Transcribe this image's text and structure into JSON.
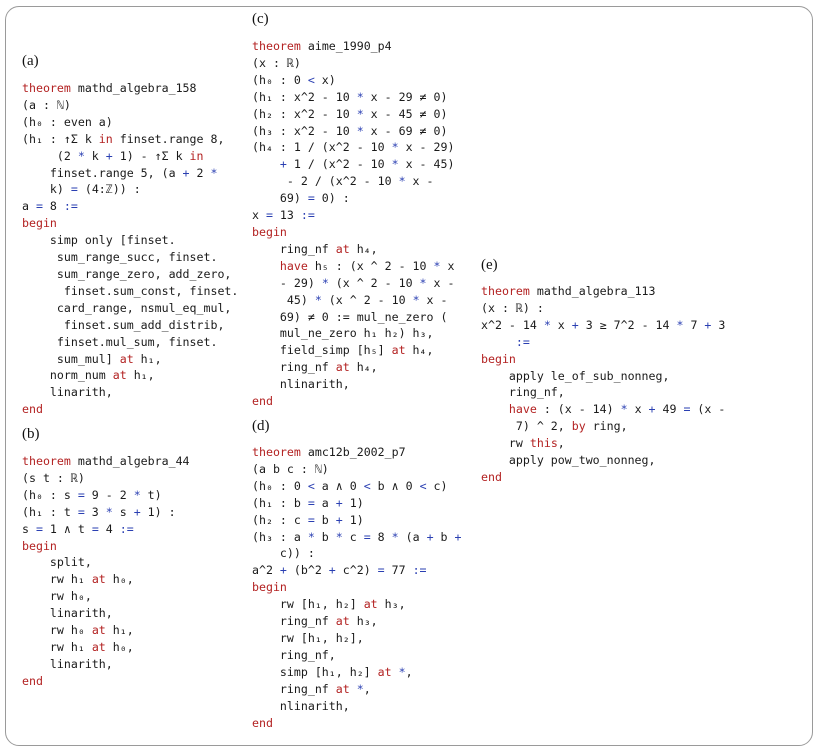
{
  "labels": {
    "a": "(a)",
    "b": "(b)",
    "c": "(c)",
    "d": "(d)",
    "e": "(e)"
  },
  "panels": {
    "a": [
      [
        [
          "k",
          "theorem"
        ],
        [
          "t",
          " mathd_algebra_158"
        ]
      ],
      [
        [
          "t",
          "(a : ℕ)"
        ]
      ],
      [
        [
          "t",
          "(h₀ : even a)"
        ]
      ],
      [
        [
          "t",
          "(h₁ : ↑Σ k "
        ],
        [
          "k",
          "in"
        ],
        [
          "t",
          " finset.range 8,"
        ]
      ],
      [
        [
          "t",
          "     (2 "
        ],
        [
          "o",
          "*"
        ],
        [
          "t",
          " k "
        ],
        [
          "o",
          "+"
        ],
        [
          "t",
          " 1) - ↑Σ k "
        ],
        [
          "k",
          "in"
        ]
      ],
      [
        [
          "t",
          "    finset.range 5, (a "
        ],
        [
          "o",
          "+"
        ],
        [
          "t",
          " 2 "
        ],
        [
          "o",
          "*"
        ]
      ],
      [
        [
          "t",
          "    k) "
        ],
        [
          "o",
          "="
        ],
        [
          "t",
          " (4:ℤ)) :"
        ]
      ],
      [
        [
          "t",
          "a "
        ],
        [
          "o",
          "="
        ],
        [
          "t",
          " 8 "
        ],
        [
          "o",
          ":="
        ]
      ],
      [
        [
          "k",
          "begin"
        ]
      ],
      [
        [
          "t",
          "    simp only [finset."
        ]
      ],
      [
        [
          "t",
          "     sum_range_succ, finset."
        ]
      ],
      [
        [
          "t",
          "     sum_range_zero, add_zero,"
        ]
      ],
      [
        [
          "t",
          "      finset.sum_const, finset."
        ]
      ],
      [
        [
          "t",
          "     card_range, nsmul_eq_mul,"
        ]
      ],
      [
        [
          "t",
          "      finset.sum_add_distrib,"
        ]
      ],
      [
        [
          "t",
          "     finset.mul_sum, finset."
        ]
      ],
      [
        [
          "t",
          "     sum_mul] "
        ],
        [
          "k",
          "at"
        ],
        [
          "t",
          " h₁,"
        ]
      ],
      [
        [
          "t",
          "    norm_num "
        ],
        [
          "k",
          "at"
        ],
        [
          "t",
          " h₁,"
        ]
      ],
      [
        [
          "t",
          "    linarith,"
        ]
      ],
      [
        [
          "k",
          "end"
        ]
      ]
    ],
    "b": [
      [
        [
          "k",
          "theorem"
        ],
        [
          "t",
          " mathd_algebra_44"
        ]
      ],
      [
        [
          "t",
          "(s t : ℝ)"
        ]
      ],
      [
        [
          "t",
          "(h₀ : s "
        ],
        [
          "o",
          "="
        ],
        [
          "t",
          " 9 - 2 "
        ],
        [
          "o",
          "*"
        ],
        [
          "t",
          " t)"
        ]
      ],
      [
        [
          "t",
          "(h₁ : t "
        ],
        [
          "o",
          "="
        ],
        [
          "t",
          " 3 "
        ],
        [
          "o",
          "*"
        ],
        [
          "t",
          " s "
        ],
        [
          "o",
          "+"
        ],
        [
          "t",
          " 1) :"
        ]
      ],
      [
        [
          "t",
          "s "
        ],
        [
          "o",
          "="
        ],
        [
          "t",
          " 1 ∧ t "
        ],
        [
          "o",
          "="
        ],
        [
          "t",
          " 4 "
        ],
        [
          "o",
          ":="
        ]
      ],
      [
        [
          "k",
          "begin"
        ]
      ],
      [
        [
          "t",
          "    split,"
        ]
      ],
      [
        [
          "t",
          "    rw h₁ "
        ],
        [
          "k",
          "at"
        ],
        [
          "t",
          " h₀,"
        ]
      ],
      [
        [
          "t",
          "    rw h₀,"
        ]
      ],
      [
        [
          "t",
          "    linarith,"
        ]
      ],
      [
        [
          "t",
          "    rw h₀ "
        ],
        [
          "k",
          "at"
        ],
        [
          "t",
          " h₁,"
        ]
      ],
      [
        [
          "t",
          "    rw h₁ "
        ],
        [
          "k",
          "at"
        ],
        [
          "t",
          " h₀,"
        ]
      ],
      [
        [
          "t",
          "    linarith,"
        ]
      ],
      [
        [
          "k",
          "end"
        ]
      ]
    ],
    "c": [
      [
        [
          "k",
          "theorem"
        ],
        [
          "t",
          " aime_1990_p4"
        ]
      ],
      [
        [
          "t",
          "(x : ℝ)"
        ]
      ],
      [
        [
          "t",
          "(h₀ : 0 "
        ],
        [
          "o",
          "<"
        ],
        [
          "t",
          " x)"
        ]
      ],
      [
        [
          "t",
          "(h₁ : x^2 - 10 "
        ],
        [
          "o",
          "*"
        ],
        [
          "t",
          " x - 29 ≠ 0)"
        ]
      ],
      [
        [
          "t",
          "(h₂ : x^2 - 10 "
        ],
        [
          "o",
          "*"
        ],
        [
          "t",
          " x - 45 ≠ 0)"
        ]
      ],
      [
        [
          "t",
          "(h₃ : x^2 - 10 "
        ],
        [
          "o",
          "*"
        ],
        [
          "t",
          " x - 69 ≠ 0)"
        ]
      ],
      [
        [
          "t",
          "(h₄ : 1 / (x^2 - 10 "
        ],
        [
          "o",
          "*"
        ],
        [
          "t",
          " x - 29)"
        ]
      ],
      [
        [
          "t",
          "    "
        ],
        [
          "o",
          "+"
        ],
        [
          "t",
          " 1 / (x^2 - 10 "
        ],
        [
          "o",
          "*"
        ],
        [
          "t",
          " x - 45)"
        ]
      ],
      [
        [
          "t",
          "     - 2 / (x^2 - 10 "
        ],
        [
          "o",
          "*"
        ],
        [
          "t",
          " x -"
        ]
      ],
      [
        [
          "t",
          "    69) "
        ],
        [
          "o",
          "="
        ],
        [
          "t",
          " 0) :"
        ]
      ],
      [
        [
          "t",
          "x "
        ],
        [
          "o",
          "="
        ],
        [
          "t",
          " 13 "
        ],
        [
          "o",
          ":="
        ]
      ],
      [
        [
          "k",
          "begin"
        ]
      ],
      [
        [
          "t",
          "    ring_nf "
        ],
        [
          "k",
          "at"
        ],
        [
          "t",
          " h₄,"
        ]
      ],
      [
        [
          "t",
          "    "
        ],
        [
          "k",
          "have"
        ],
        [
          "t",
          " h₅ : (x ^ 2 - 10 "
        ],
        [
          "o",
          "*"
        ],
        [
          "t",
          " x"
        ]
      ],
      [
        [
          "t",
          "    - 29) "
        ],
        [
          "o",
          "*"
        ],
        [
          "t",
          " (x ^ 2 - 10 "
        ],
        [
          "o",
          "*"
        ],
        [
          "t",
          " x -"
        ]
      ],
      [
        [
          "t",
          "     45) "
        ],
        [
          "o",
          "*"
        ],
        [
          "t",
          " (x ^ 2 - 10 "
        ],
        [
          "o",
          "*"
        ],
        [
          "t",
          " x -"
        ]
      ],
      [
        [
          "t",
          "    69) ≠ 0 := mul_ne_zero ("
        ]
      ],
      [
        [
          "t",
          "    mul_ne_zero h₁ h₂) h₃,"
        ]
      ],
      [
        [
          "t",
          "    field_simp [h₅] "
        ],
        [
          "k",
          "at"
        ],
        [
          "t",
          " h₄,"
        ]
      ],
      [
        [
          "t",
          "    ring_nf "
        ],
        [
          "k",
          "at"
        ],
        [
          "t",
          " h₄,"
        ]
      ],
      [
        [
          "t",
          "    nlinarith,"
        ]
      ],
      [
        [
          "k",
          "end"
        ]
      ]
    ],
    "d": [
      [
        [
          "k",
          "theorem"
        ],
        [
          "t",
          " amc12b_2002_p7"
        ]
      ],
      [
        [
          "t",
          "(a b c : ℕ)"
        ]
      ],
      [
        [
          "t",
          "(h₀ : 0 "
        ],
        [
          "o",
          "<"
        ],
        [
          "t",
          " a ∧ 0 "
        ],
        [
          "o",
          "<"
        ],
        [
          "t",
          " b ∧ 0 "
        ],
        [
          "o",
          "<"
        ],
        [
          "t",
          " c)"
        ]
      ],
      [
        [
          "t",
          "(h₁ : b "
        ],
        [
          "o",
          "="
        ],
        [
          "t",
          " a "
        ],
        [
          "o",
          "+"
        ],
        [
          "t",
          " 1)"
        ]
      ],
      [
        [
          "t",
          "(h₂ : c "
        ],
        [
          "o",
          "="
        ],
        [
          "t",
          " b "
        ],
        [
          "o",
          "+"
        ],
        [
          "t",
          " 1)"
        ]
      ],
      [
        [
          "t",
          "(h₃ : a "
        ],
        [
          "o",
          "*"
        ],
        [
          "t",
          " b "
        ],
        [
          "o",
          "*"
        ],
        [
          "t",
          " c "
        ],
        [
          "o",
          "="
        ],
        [
          "t",
          " 8 "
        ],
        [
          "o",
          "*"
        ],
        [
          "t",
          " (a "
        ],
        [
          "o",
          "+"
        ],
        [
          "t",
          " b "
        ],
        [
          "o",
          "+"
        ]
      ],
      [
        [
          "t",
          "    c)) :"
        ]
      ],
      [
        [
          "t",
          "a^2 "
        ],
        [
          "o",
          "+"
        ],
        [
          "t",
          " (b^2 "
        ],
        [
          "o",
          "+"
        ],
        [
          "t",
          " c^2) "
        ],
        [
          "o",
          "="
        ],
        [
          "t",
          " 77 "
        ],
        [
          "o",
          ":="
        ]
      ],
      [
        [
          "k",
          "begin"
        ]
      ],
      [
        [
          "t",
          "    rw [h₁, h₂] "
        ],
        [
          "k",
          "at"
        ],
        [
          "t",
          " h₃,"
        ]
      ],
      [
        [
          "t",
          "    ring_nf "
        ],
        [
          "k",
          "at"
        ],
        [
          "t",
          " h₃,"
        ]
      ],
      [
        [
          "t",
          "    rw [h₁, h₂],"
        ]
      ],
      [
        [
          "t",
          "    ring_nf,"
        ]
      ],
      [
        [
          "t",
          "    simp [h₁, h₂] "
        ],
        [
          "k",
          "at"
        ],
        [
          "t",
          " "
        ],
        [
          "o",
          "*"
        ],
        [
          "t",
          ","
        ]
      ],
      [
        [
          "t",
          "    ring_nf "
        ],
        [
          "k",
          "at"
        ],
        [
          "t",
          " "
        ],
        [
          "o",
          "*"
        ],
        [
          "t",
          ","
        ]
      ],
      [
        [
          "t",
          "    nlinarith,"
        ]
      ],
      [
        [
          "k",
          "end"
        ]
      ]
    ],
    "e": [
      [
        [
          "k",
          "theorem"
        ],
        [
          "t",
          " mathd_algebra_113"
        ]
      ],
      [
        [
          "t",
          "(x : ℝ) :"
        ]
      ],
      [
        [
          "t",
          "x^2 - 14 "
        ],
        [
          "o",
          "*"
        ],
        [
          "t",
          " x "
        ],
        [
          "o",
          "+"
        ],
        [
          "t",
          " 3 ≥ 7^2 - 14 "
        ],
        [
          "o",
          "*"
        ],
        [
          "t",
          " 7 "
        ],
        [
          "o",
          "+"
        ],
        [
          "t",
          " 3"
        ]
      ],
      [
        [
          "t",
          "     "
        ],
        [
          "o",
          ":="
        ]
      ],
      [
        [
          "k",
          "begin"
        ]
      ],
      [
        [
          "t",
          "    apply le_of_sub_nonneg,"
        ]
      ],
      [
        [
          "t",
          "    ring_nf,"
        ]
      ],
      [
        [
          "t",
          "    "
        ],
        [
          "k",
          "have"
        ],
        [
          "t",
          " : (x - 14) "
        ],
        [
          "o",
          "*"
        ],
        [
          "t",
          " x "
        ],
        [
          "o",
          "+"
        ],
        [
          "t",
          " 49 "
        ],
        [
          "o",
          "="
        ],
        [
          "t",
          " (x -"
        ]
      ],
      [
        [
          "t",
          "     7) ^ 2, "
        ],
        [
          "k",
          "by"
        ],
        [
          "t",
          " ring,"
        ]
      ],
      [
        [
          "t",
          "    rw "
        ],
        [
          "k",
          "this"
        ],
        [
          "t",
          ","
        ]
      ],
      [
        [
          "t",
          "    apply pow_two_nonneg,"
        ]
      ],
      [
        [
          "k",
          "end"
        ]
      ]
    ]
  }
}
